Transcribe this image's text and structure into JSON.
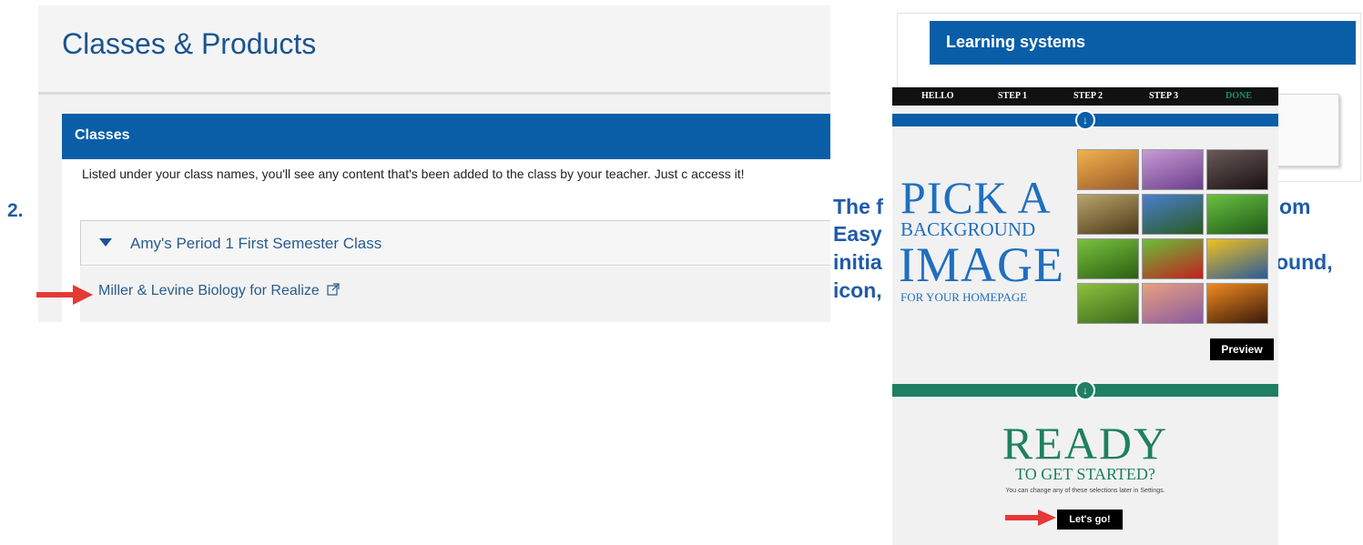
{
  "step_number": "2.",
  "left_screenshot": {
    "page_title": "Classes & Products",
    "section_title": "Classes",
    "intro_text": "Listed under your class names, you'll see any content that's been added to the class by your teacher. Just c access it!",
    "class_name": "Amy's Period 1 First Semester Class",
    "product_link": "Miller & Levine Biology for Realize"
  },
  "overlay_text": {
    "line1": "The f",
    "line1_end": "om",
    "line2": "Easy",
    "line3": "initia",
    "line3_end": "ound,",
    "line4": "icon,"
  },
  "learning_systems": {
    "title": "Learning systems"
  },
  "onboarding": {
    "nav": [
      "HELLO",
      "STEP 1",
      "STEP 2",
      "STEP 3",
      "DONE"
    ],
    "pick_a": "PICK A",
    "background": "BACKGROUND",
    "image": "IMAGE",
    "for_homepage": "FOR YOUR HOMEPAGE",
    "preview_label": "Preview",
    "ready": "READY",
    "to_get_started": "TO GET STARTED?",
    "change_note": "You can change any of these selections later in Settings.",
    "lets_go_label": "Let's go!",
    "arrow_glyph": "↓",
    "thumbnails": [
      {
        "name": "sunset-field",
        "colors": [
          "#f2b24c",
          "#9a5a2a"
        ]
      },
      {
        "name": "butterfly",
        "colors": [
          "#c99ad6",
          "#6a3e8a"
        ]
      },
      {
        "name": "nebula",
        "colors": [
          "#6a5a5a",
          "#1a1010"
        ]
      },
      {
        "name": "leaf-insect",
        "colors": [
          "#b9a46a",
          "#4c3a1a"
        ]
      },
      {
        "name": "bluebonnets",
        "colors": [
          "#4a7fd0",
          "#2a5a20"
        ]
      },
      {
        "name": "tree-frog",
        "colors": [
          "#6ac040",
          "#1e5a1a"
        ]
      },
      {
        "name": "green-leaves",
        "colors": [
          "#7bc040",
          "#2a6010"
        ]
      },
      {
        "name": "strawberry",
        "colors": [
          "#6abf3a",
          "#c02020"
        ]
      },
      {
        "name": "sunflowers",
        "colors": [
          "#f0c020",
          "#2a5a9a"
        ]
      },
      {
        "name": "tea-fields",
        "colors": [
          "#8cc040",
          "#3a6a1a"
        ]
      },
      {
        "name": "pier-sunset",
        "colors": [
          "#e8a080",
          "#8a5aa0"
        ]
      },
      {
        "name": "pyramids",
        "colors": [
          "#f08a20",
          "#3a1a0a"
        ]
      }
    ]
  }
}
